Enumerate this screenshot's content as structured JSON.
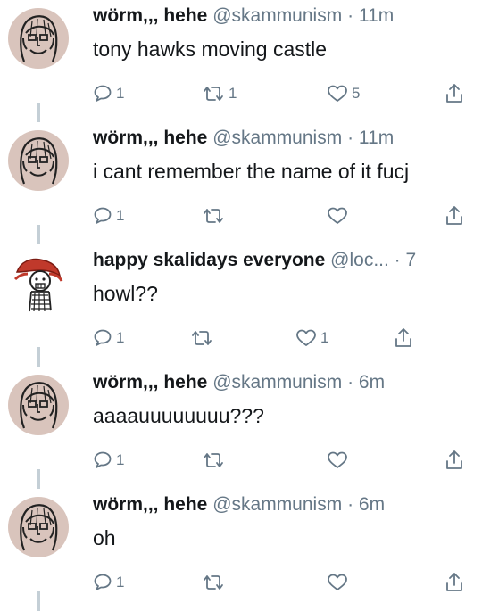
{
  "tweets": [
    {
      "name": "wörm,,, hehe",
      "handle": "@skammunism",
      "separator": "·",
      "time": "11m",
      "text": "tony hawks moving castle",
      "replies": "1",
      "retweets": "1",
      "likes": "5",
      "avatar": "worm-face-avatar"
    },
    {
      "name": "wörm,,, hehe",
      "handle": "@skammunism",
      "separator": "·",
      "time": "11m",
      "text": "i cant remember the name of it fucj",
      "replies": "1",
      "retweets": "",
      "likes": "",
      "avatar": "worm-face-avatar"
    },
    {
      "name": "happy skalidays everyone",
      "handle": "@loc...",
      "separator": "·",
      "time": "7",
      "text": "howl??",
      "replies": "1",
      "retweets": "",
      "likes": "1",
      "avatar": "red-hair-drawing-avatar"
    },
    {
      "name": "wörm,,, hehe",
      "handle": "@skammunism",
      "separator": "·",
      "time": "6m",
      "text": "aaaauuuuuuuu???",
      "replies": "1",
      "retweets": "",
      "likes": "",
      "avatar": "worm-face-avatar"
    },
    {
      "name": "wörm,,, hehe",
      "handle": "@skammunism",
      "separator": "·",
      "time": "6m",
      "text": "oh",
      "replies": "1",
      "retweets": "",
      "likes": "",
      "avatar": "worm-face-avatar"
    }
  ],
  "icons": {
    "reply": "reply-icon",
    "retweet": "retweet-icon",
    "like": "heart-icon",
    "share": "share-icon"
  },
  "colors": {
    "text": "#14171a",
    "secondary": "#657786",
    "thread_line": "#c4cfd6",
    "avatar_bg": "#d9c4bc"
  }
}
